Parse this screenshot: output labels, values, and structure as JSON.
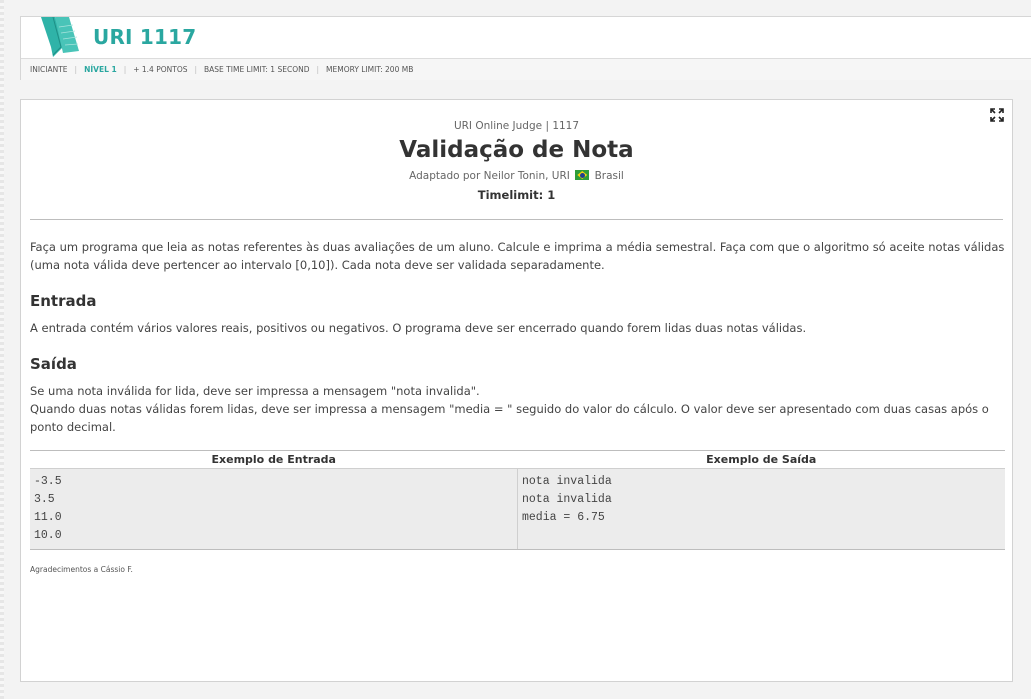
{
  "header": {
    "problem_title": "URI 1117",
    "infobar": {
      "category": "INICIANTE",
      "level": "NÍVEL 1",
      "points": "+ 1.4 PONTOS",
      "time_limit": "BASE TIME LIMIT: 1 SECOND",
      "memory_limit": "MEMORY LIMIT: 200 MB"
    }
  },
  "problem": {
    "judge_line": "URI Online Judge | 1117",
    "title": "Validação de Nota",
    "author_prefix": "Adaptado por Neilor Tonin, URI",
    "country": "Brasil",
    "timelimit": "Timelimit: 1",
    "statement": "Faça um programa que leia as notas referentes às duas avaliações de um aluno. Calcule e imprima a média semestral. Faça com que o algoritmo só aceite notas válidas (uma nota válida deve pertencer ao intervalo [0,10]). Cada nota deve ser validada separadamente.",
    "input_heading": "Entrada",
    "input_text": "A entrada contém vários valores reais, positivos ou negativos. O programa deve ser encerrado quando forem lidas duas notas válidas.",
    "output_heading": "Saída",
    "output_text_1": "Se uma nota inválida  for lida, deve ser impressa a mensagem \"nota invalida\".",
    "output_text_2": "Quando duas notas válidas forem lidas, deve ser impressa a mensagem \"media = \" seguido do valor do cálculo. O valor deve ser apresentado com duas casas após o ponto decimal.",
    "sample_input_header": "Exemplo de Entrada",
    "sample_output_header": "Exemplo de Saída",
    "sample_input": [
      "-3.5",
      "3.5",
      "11.0",
      "10.0"
    ],
    "sample_output": [
      "nota invalida",
      "nota invalida",
      "media = 6.75"
    ],
    "thanks": "Agradecimentos a Cássio F."
  },
  "colors": {
    "accent": "#2aa7a0",
    "sample_bg": "#ececec"
  },
  "icons": {
    "logo": "uri-logo-icon",
    "expand": "expand-icon",
    "flag": "brazil-flag-icon"
  }
}
